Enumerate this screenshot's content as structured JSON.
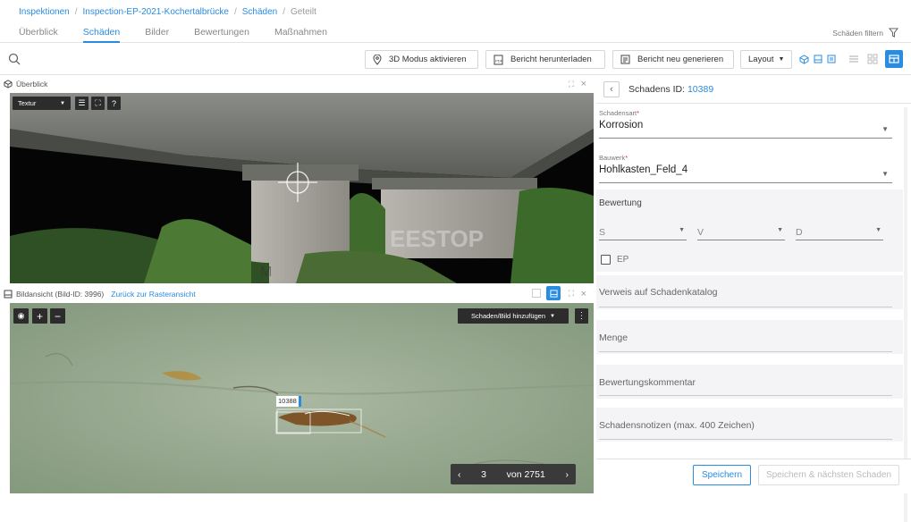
{
  "breadcrumb": [
    "Inspektionen",
    "Inspection-EP-2021-Kochertalbrücke",
    "Schäden",
    "Geteilt"
  ],
  "tabs": [
    "Überblick",
    "Schäden",
    "Bilder",
    "Bewertungen",
    "Maßnahmen"
  ],
  "active_tab": "Schäden",
  "filter_label": "Schäden filtern",
  "toolbar": {
    "mode3d": "3D Modus aktivieren",
    "download": "Bericht herunterladen",
    "regen": "Bericht neu generieren",
    "layout": "Layout"
  },
  "overview": {
    "title": "Überblick",
    "texture_label": "Textur"
  },
  "image_view": {
    "title": "Bildansicht (Bild-ID: 3996)",
    "back_link": "Zurück zur Rasteransicht",
    "add_button": "Schaden/Bild hinzufügen",
    "marker_label": "10388",
    "page_current": "3",
    "page_total": "von 2751"
  },
  "detail": {
    "id_label": "Schadens ID:",
    "id_value": "10389",
    "damage_type_label": "Schadensart",
    "damage_type_value": "Korrosion",
    "structure_label": "Bauwerk",
    "structure_value": "Hohlkasten_Feld_4",
    "rating_label": "Bewertung",
    "rating_s": "S",
    "rating_v": "V",
    "rating_d": "D",
    "ep_label": "EP",
    "catalog_ref": "Verweis auf Schadenkatalog",
    "quantity": "Menge",
    "rating_comment": "Bewertungskommentar",
    "notes": "Schadensnotizen (max. 400 Zeichen)",
    "save": "Speichern",
    "save_next": "Speichern & nächsten Schaden"
  },
  "colors": {
    "accent": "#2a8ce0",
    "dark_button": "#2c2c2c"
  }
}
